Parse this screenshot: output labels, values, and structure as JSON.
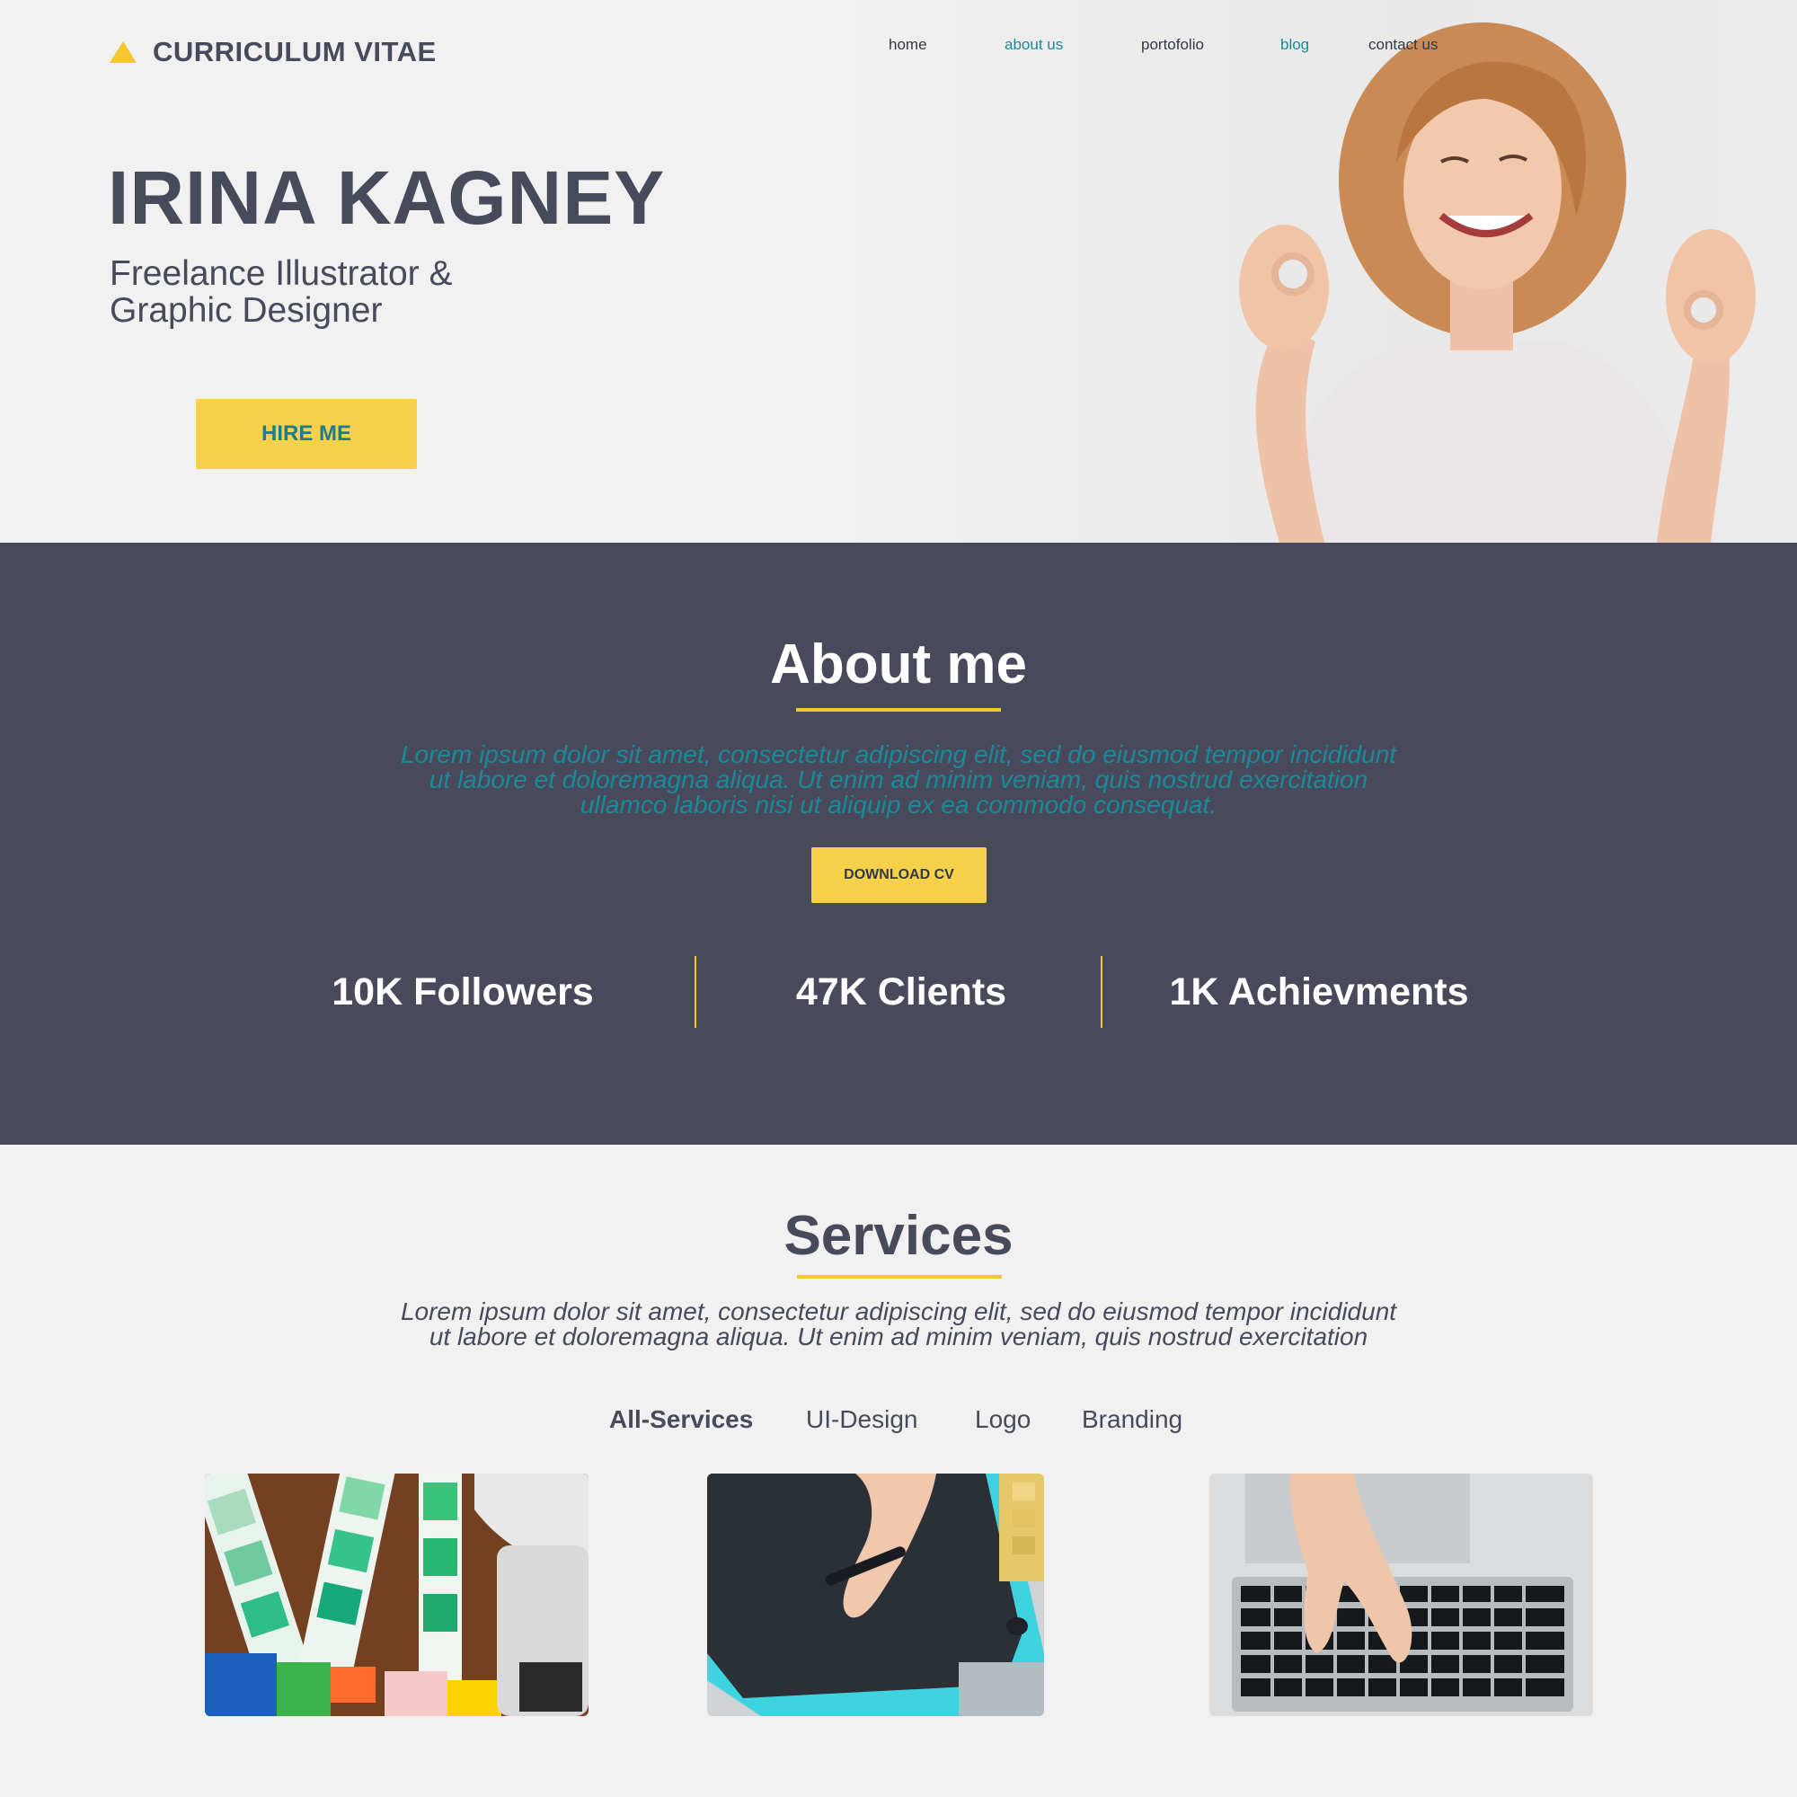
{
  "header": {
    "logo_text": "CURRICULUM VITAE",
    "nav": [
      {
        "label": "home"
      },
      {
        "label": "about us"
      },
      {
        "label": "portofolio"
      },
      {
        "label": "blog"
      },
      {
        "label": "contact us"
      }
    ]
  },
  "hero": {
    "name": "IRINA KAGNEY",
    "role_line1": "Freelance Illustrator &",
    "role_line2": "Graphic Designer",
    "hire_button": "HIRE ME"
  },
  "about": {
    "title": "About me",
    "text_line1": "Lorem ipsum dolor sit amet, consectetur adipiscing elit, sed do eiusmod tempor incididunt",
    "text_line2": "ut labore et doloremagna aliqua. Ut enim ad minim veniam, quis nostrud exercitation",
    "text_line3": "ullamco laboris nisi ut aliquip ex ea commodo consequat.",
    "download_button": "DOWNLOAD CV",
    "stats": [
      {
        "label": "10K Followers"
      },
      {
        "label": "47K Clients"
      },
      {
        "label": "1K Achievments"
      }
    ]
  },
  "services": {
    "title": "Services",
    "text_line1": "Lorem ipsum dolor sit amet, consectetur adipiscing elit, sed do eiusmod tempor incididunt",
    "text_line2": "ut labore et doloremagna aliqua. Ut enim ad minim veniam, quis nostrud exercitation",
    "tabs": [
      {
        "label": "All-Services"
      },
      {
        "label": "UI-Design"
      },
      {
        "label": "Logo"
      },
      {
        "label": "Branding"
      }
    ]
  },
  "colors": {
    "accent_yellow": "#f8d14a",
    "dark_slate": "#484a5b",
    "teal": "#1b8a99"
  }
}
